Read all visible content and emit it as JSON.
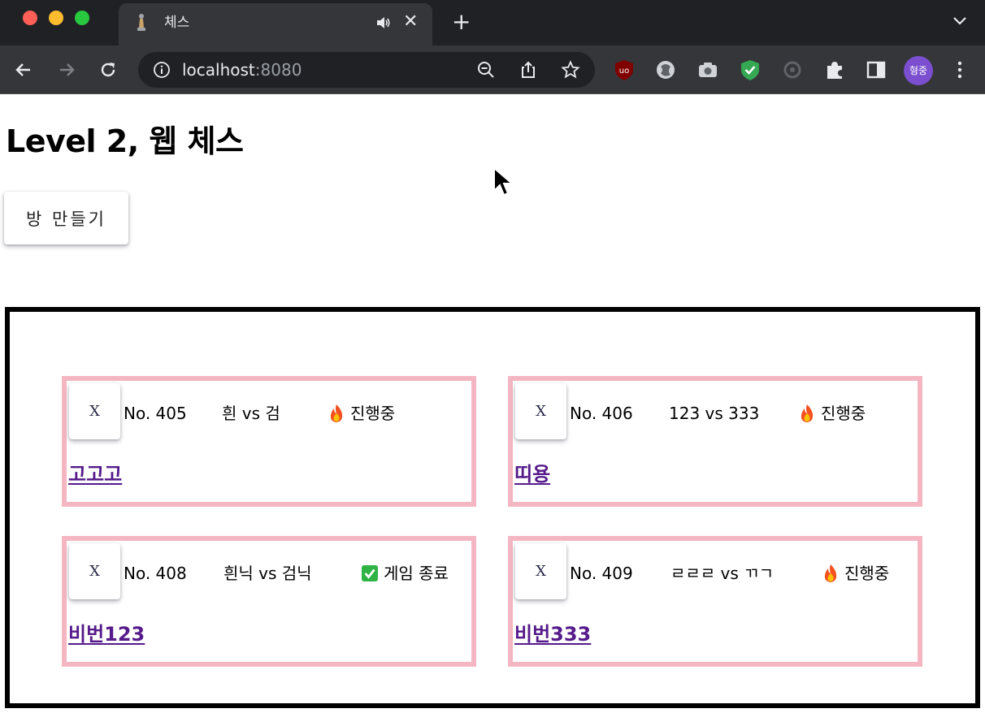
{
  "browser": {
    "tab": {
      "title": "체스"
    },
    "address_bar": {
      "host": "localhost",
      "port": ":8080"
    },
    "profile_initials": "형중"
  },
  "page": {
    "title": "Level 2, 웹 체스",
    "create_room_label": "방 만들기"
  },
  "rooms": [
    {
      "delete_label": "X",
      "number": "No. 405",
      "players": "흰 vs 검",
      "status": "진행중",
      "status_icon": "fire-icon",
      "name": "고고고"
    },
    {
      "delete_label": "X",
      "number": "No. 406",
      "players": "123 vs 333",
      "status": "진행중",
      "status_icon": "fire-icon",
      "name": "띠용"
    },
    {
      "delete_label": "X",
      "number": "No. 408",
      "players": "흰닉 vs 검닉",
      "status": "게임 종료",
      "status_icon": "check-icon",
      "name": "비번123"
    },
    {
      "delete_label": "X",
      "number": "No. 409",
      "players": "ㄹㄹㄹ vs ㄲㄱ",
      "status": "진행중",
      "status_icon": "fire-icon",
      "name": "비번333"
    }
  ],
  "colors": {
    "room_border": "#f4b6c2",
    "list_border": "#000000",
    "link": "#551a8b",
    "chrome_dark": "#202124",
    "chrome_toolbar": "#35363a"
  }
}
